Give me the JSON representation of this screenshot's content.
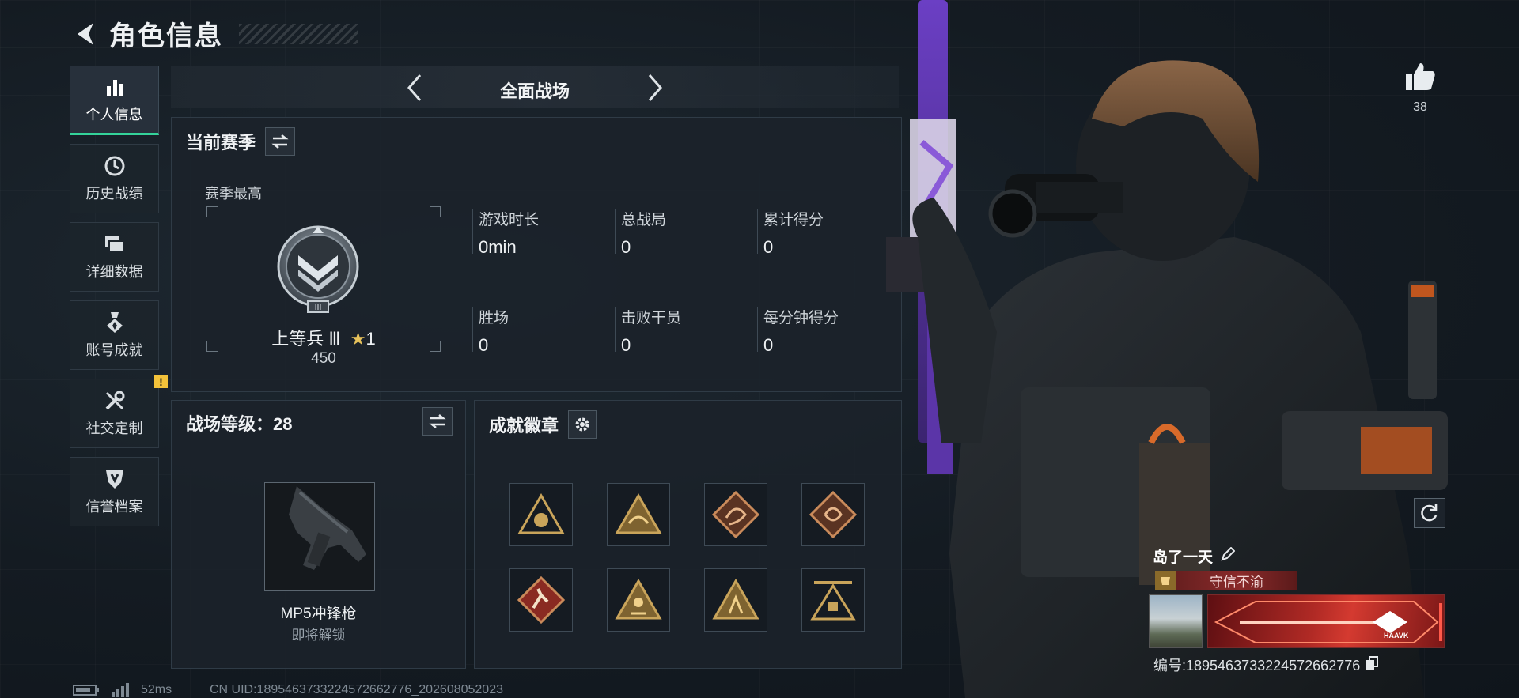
{
  "header": {
    "title": "角色信息"
  },
  "sidebar": {
    "items": [
      {
        "label": "个人信息",
        "icon": "bar-chart-icon",
        "active": true
      },
      {
        "label": "历史战绩",
        "icon": "history-clock-icon"
      },
      {
        "label": "详细数据",
        "icon": "folder-stack-icon"
      },
      {
        "label": "账号成就",
        "icon": "achievement-medal-icon"
      },
      {
        "label": "社交定制",
        "icon": "tools-wrench-icon",
        "badge": "!"
      },
      {
        "label": "信誉档案",
        "icon": "shield-crest-icon"
      }
    ]
  },
  "mode": {
    "label": "全面战场"
  },
  "season": {
    "title": "当前赛季",
    "best_label": "赛季最高",
    "rank_name": "上等兵 Ⅲ",
    "rank_stars": "1",
    "rank_points": "450",
    "stats": [
      {
        "key": "游戏时长",
        "value": "0min"
      },
      {
        "key": "总战局",
        "value": "0"
      },
      {
        "key": "累计得分",
        "value": "0"
      },
      {
        "key": "胜场",
        "value": "0"
      },
      {
        "key": "击败干员",
        "value": "0"
      },
      {
        "key": "每分钟得分",
        "value": "0"
      }
    ]
  },
  "battlefield_level": {
    "title": "战场等级：28",
    "weapon_name": "MP5冲锋枪",
    "weapon_status": "即将解锁"
  },
  "achievements": {
    "title": "成就徽章",
    "badges": [
      "badge-1",
      "badge-2",
      "badge-3",
      "badge-4",
      "badge-5",
      "badge-6",
      "badge-7",
      "badge-8"
    ]
  },
  "profile": {
    "like_count": "38",
    "player_name": "岛了一天",
    "title_tag": "守信不渝",
    "player_id": "编号:1895463733224572662776",
    "nameplate_brand": "HAAVK"
  },
  "status": {
    "ping": "52ms",
    "uid": "CN UID:1895463733224572662776_202608052023"
  },
  "colors": {
    "accent": "#34d39a",
    "warning": "#f3c23a",
    "badge_gold": "#c9a45a"
  }
}
